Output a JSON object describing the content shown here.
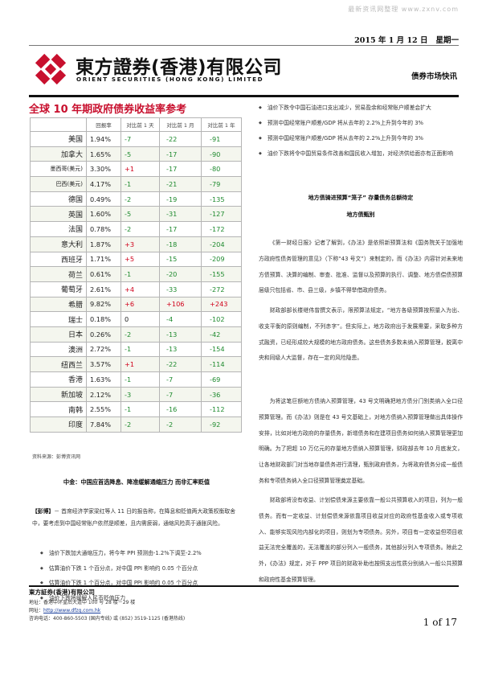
{
  "watermark": "最新资讯网整理 www.zxnv.com",
  "header": {
    "date": "2015 年 1 月 12 日",
    "weekday": "星期一",
    "company_cn": "東方證券(香港)有限公司",
    "company_en": "ORIENT SECURITIES (HONG KONG) LIMITED",
    "section": "债券市场快讯",
    "logo_colors": {
      "red": "#c8102e",
      "dark": "#111111"
    }
  },
  "table": {
    "title": "全球 10 年期政府债券收益率参考",
    "columns": [
      "",
      "回报率",
      "对比前 1 天",
      "对比前 1 月",
      "对比前 1 年"
    ],
    "rows": [
      {
        "country": "美国",
        "rate": "1.94%",
        "d1": "-7",
        "m1": "-22",
        "y1": "-91"
      },
      {
        "country": "加拿大",
        "rate": "1.65%",
        "d1": "-5",
        "m1": "-17",
        "y1": "-90"
      },
      {
        "country": "墨西哥(美元)",
        "rate": "3.30%",
        "d1": "+1",
        "m1": "-17",
        "y1": "-80"
      },
      {
        "country": "巴西(美元)",
        "rate": "4.17%",
        "d1": "-1",
        "m1": "-21",
        "y1": "-79"
      },
      {
        "country": "德国",
        "rate": "0.49%",
        "d1": "-2",
        "m1": "-19",
        "y1": "-135"
      },
      {
        "country": "英国",
        "rate": "1.60%",
        "d1": "-5",
        "m1": "-31",
        "y1": "-127"
      },
      {
        "country": "法国",
        "rate": "0.78%",
        "d1": "-2",
        "m1": "-17",
        "y1": "-172"
      },
      {
        "country": "意大利",
        "rate": "1.87%",
        "d1": "+3",
        "m1": "-18",
        "y1": "-204"
      },
      {
        "country": "西班牙",
        "rate": "1.71%",
        "d1": "+5",
        "m1": "-15",
        "y1": "-209"
      },
      {
        "country": "荷兰",
        "rate": "0.61%",
        "d1": "-1",
        "m1": "-20",
        "y1": "-155"
      },
      {
        "country": "葡萄牙",
        "rate": "2.61%",
        "d1": "+4",
        "m1": "-33",
        "y1": "-272"
      },
      {
        "country": "希腊",
        "rate": "9.82%",
        "d1": "+6",
        "m1": "+106",
        "y1": "+243"
      },
      {
        "country": "瑞士",
        "rate": "0.18%",
        "d1": "0",
        "m1": "-4",
        "y1": "-102"
      },
      {
        "country": "日本",
        "rate": "0.26%",
        "d1": "-2",
        "m1": "-13",
        "y1": "-42"
      },
      {
        "country": "澳洲",
        "rate": "2.72%",
        "d1": "-1",
        "m1": "-13",
        "y1": "-154"
      },
      {
        "country": "纽西兰",
        "rate": "3.57%",
        "d1": "+1",
        "m1": "-22",
        "y1": "-114"
      },
      {
        "country": "香港",
        "rate": "1.63%",
        "d1": "-1",
        "m1": "-7",
        "y1": "-69"
      },
      {
        "country": "新加坡",
        "rate": "2.12%",
        "d1": "-3",
        "m1": "-7",
        "y1": "-36"
      },
      {
        "country": "南韩",
        "rate": "2.55%",
        "d1": "-1",
        "m1": "-16",
        "y1": "-112"
      },
      {
        "country": "印度",
        "rate": "7.84%",
        "d1": "-2",
        "m1": "-2",
        "y1": "-92"
      }
    ],
    "colors": {
      "up": "#d0021b",
      "down": "#1e8a2e"
    },
    "source": "资料来源：彭博资讯网"
  },
  "left_article": {
    "headline": "中金：中国应首选降息、降准缓解通缩压力 而非汇率贬值",
    "lead_tag": "【彭博】",
    "lead_text": "－ 首席经济学家梁红等人 11 日的报告称，在降息和贬值两大政策权衡取舍中，要考虑到中国经常账户依然是顺差，且内需疲弱，通缩风险高于通胀风险。",
    "bullets": [
      "油价下跌加大通缩压力，将今年 PPI 预测由-1.2%下调至-2.2%",
      "估算油价下跌 1 个百分点，对中国 PPI 影响约 0.05 个百分点",
      "估算油价下跌 1 个百分点，对中国 PPI 影响约 0.05 个百分点",
      "油价下跌将缓解人民币贬值压力"
    ]
  },
  "right_column": {
    "bullets": [
      "油价下跌令中国石油进口支出减少，贸易盈余和经常账户顺差会扩大",
      "预测中国经常账户顺差/GDP 将从去年的 2.2%上升到今年的 3%",
      "预测中国经常账户顺差/GDP 将从去年的 2.2%上升到今年的 3%",
      "油价下跌将令中国贸易条件改善和国民收入增加，对经济供给面亦有正面影响"
    ],
    "headline": "地方债骑进预算“笼子” 存量债务总额待定",
    "subheadline": "地方债甄别",
    "paragraphs": [
      "《第一财经日报》记者了解到，《办法》是依照新预算法和《国务院关于加强地方政府性债务管理的意见》（下称“43 号文”）来制定的，而《办法》内容针对未来地方债预算、决算的编制、审查、批准、监督以及预算的执行、调整、地方债偿债预算层级只包括省、市、县三级，乡镇不得举借政府债务。",
      "财政部部长楼继伟曾撰文表示，限预算法规定，“地方各级预算按照量入为出、收支平衡的原则编制，不列赤字”。但实际上，地方政府出于发展需要，采取多种方式融资，已经形成较大规模的地方政府债务。这些债务多数未纳入预算管理，脱离中央和同级人大监督，存在一定的风险隐患。",
      "为将这笔巨额地方债纳入预算管理，43 号文明确把地方债分门别类纳入全口径预算管理。而《办法》则是在 43 号文基础上，对地方债纳入预算管理做出具体操作安排，比如对地方政府的存量债务，新增债务和在建项目债务如何纳入预算管理更加明确。为了把超 10 万亿元的存量地方债纳入预算管理，财政部去年 10 月底发文，让各地财政部门对当地存量债务进行清理，甄别政府债务，为将政府债务分成一般债务和专项债务纳入全口径预算管理奠定基础。",
      "财政部将没有收益、计划偿债来源主要依靠一般公共预算收入的项目，列为一般债务。而有一定收益、计划偿债来源依靠项目收益对应的政府性基金收入或专项收入、能够实现风险内部化的项目，则划为专项债务。另外，项目有一定收益但项目收益无法完全覆盖的，无法覆盖的部分列入一般债务，其他部分列入专项债务。除此之外，《办法》规定，对于 PPP 项目的财政补助也按照支出性质分别纳入一般公共预算和政府性基金预算管理。"
    ]
  },
  "footer": {
    "company": "東方証券(香港)有限公司",
    "address": "地址：香港中环皇后大道中 100 号 28 楼－29 楼",
    "website_label": "网址：",
    "website": "http://www.dfzq.com.hk",
    "phone": "咨询电话：400-860-5503 (国内专线)  或  (852) 3519-1125 (香港热线)",
    "page": "1 of 17"
  }
}
